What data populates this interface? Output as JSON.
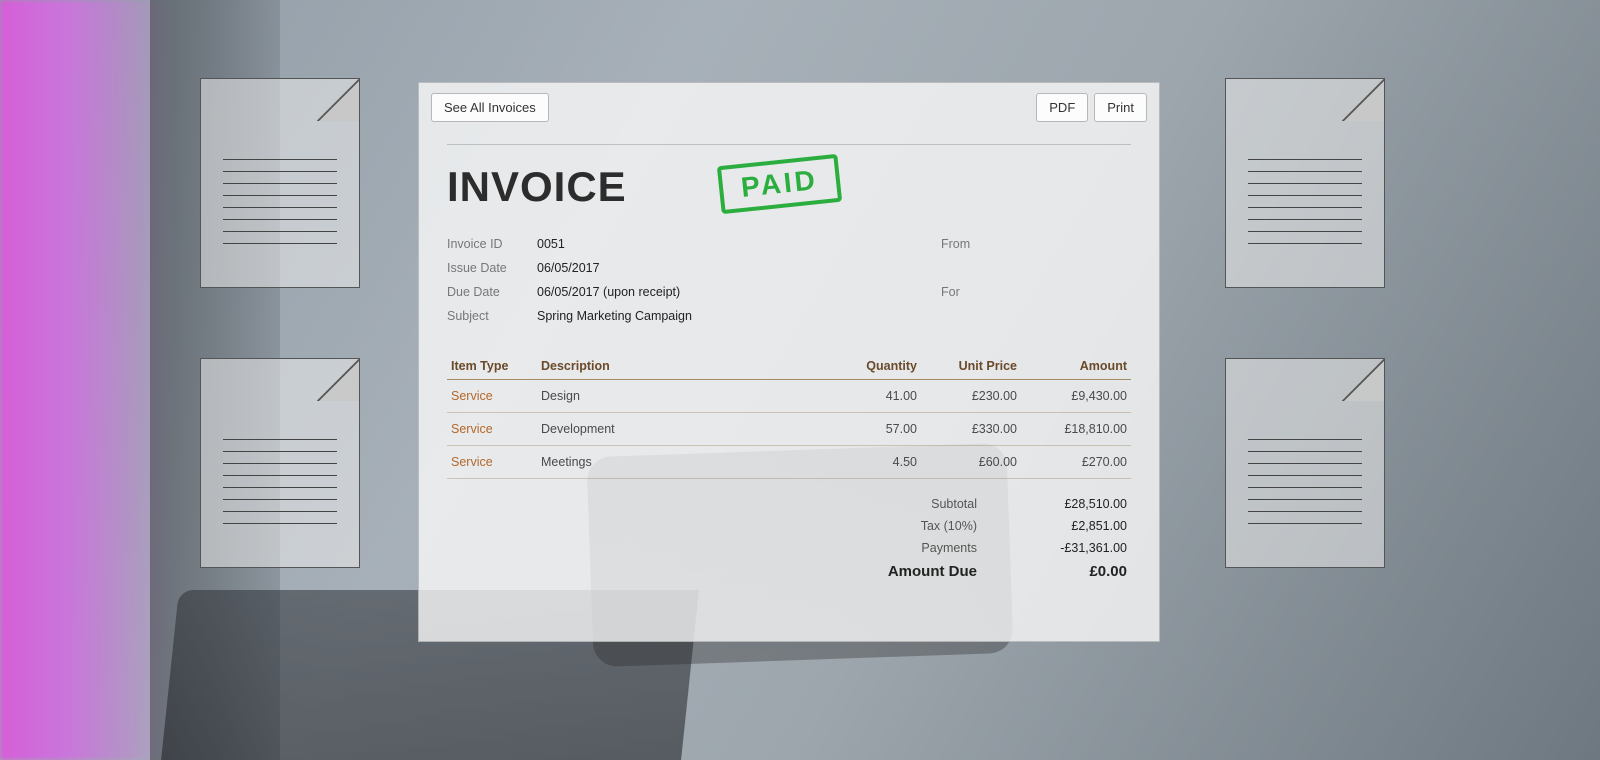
{
  "toolbar": {
    "see_all": "See All Invoices",
    "pdf": "PDF",
    "print": "Print"
  },
  "header": {
    "title": "INVOICE",
    "stamp": "PAID",
    "from_label": "From",
    "for_label": "For"
  },
  "meta": {
    "invoice_id_label": "Invoice ID",
    "invoice_id": "0051",
    "issue_date_label": "Issue Date",
    "issue_date": "06/05/2017",
    "due_date_label": "Due Date",
    "due_date": "06/05/2017 (upon receipt)",
    "subject_label": "Subject",
    "subject": "Spring Marketing Campaign"
  },
  "columns": {
    "item_type": "Item Type",
    "description": "Description",
    "quantity": "Quantity",
    "unit_price": "Unit Price",
    "amount": "Amount"
  },
  "lines": [
    {
      "type": "Service",
      "desc": "Design",
      "qty": "41.00",
      "unit": "£230.00",
      "amount": "£9,430.00"
    },
    {
      "type": "Service",
      "desc": "Development",
      "qty": "57.00",
      "unit": "£330.00",
      "amount": "£18,810.00"
    },
    {
      "type": "Service",
      "desc": "Meetings",
      "qty": "4.50",
      "unit": "£60.00",
      "amount": "£270.00"
    }
  ],
  "totals": {
    "subtotal_label": "Subtotal",
    "subtotal": "£28,510.00",
    "tax_label": "Tax (10%)",
    "tax": "£2,851.00",
    "payments_label": "Payments",
    "payments": "-£31,361.00",
    "due_label": "Amount Due",
    "due": "£0.00"
  }
}
